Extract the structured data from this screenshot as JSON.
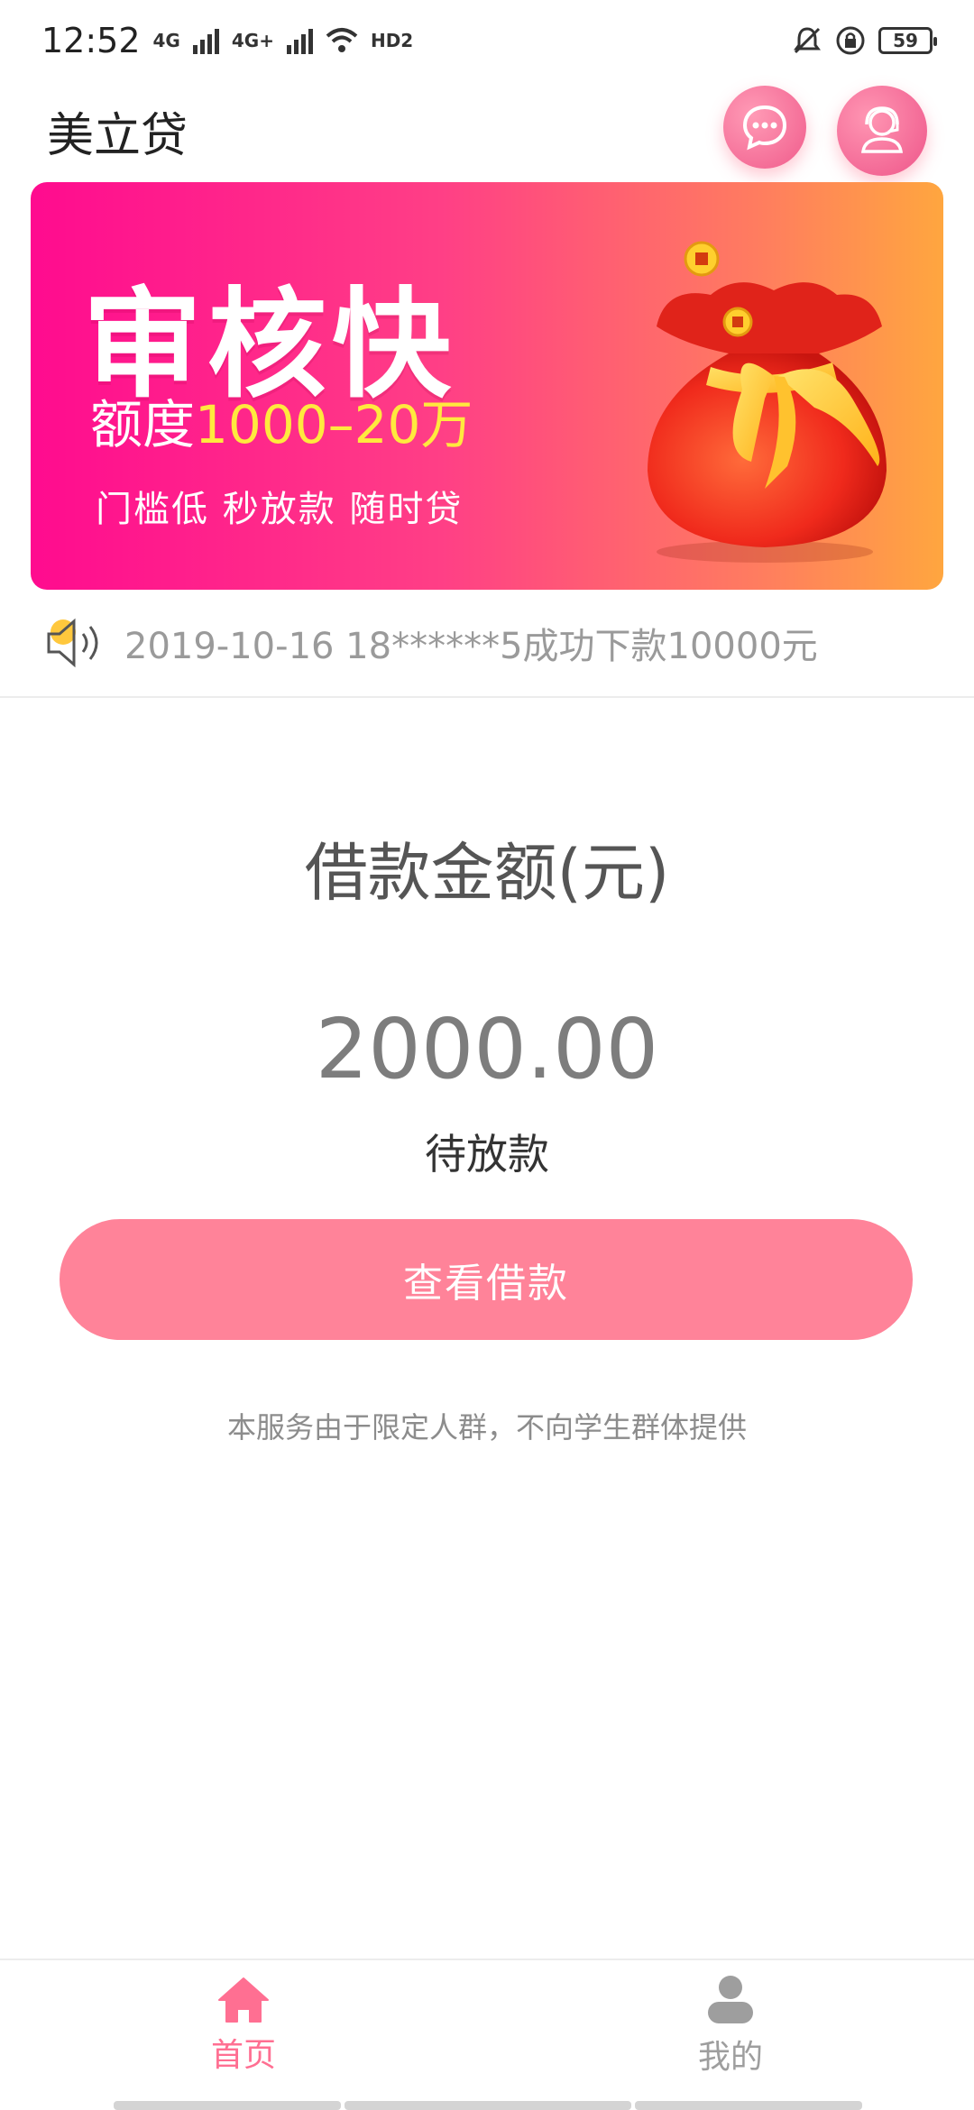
{
  "status_bar": {
    "time": "12:52",
    "network_1": "4G",
    "network_2": "4G+",
    "hd": "HD",
    "hd_sub": "2",
    "battery": "59",
    "icons": [
      "signal-icon",
      "signal-icon",
      "wifi-icon",
      "hd-icon",
      "mute-icon",
      "rotation-lock-icon",
      "battery-icon"
    ]
  },
  "header": {
    "title": "美立贷",
    "actions": [
      "chat-icon",
      "customer-service-icon"
    ]
  },
  "banner": {
    "headline": "审核快",
    "quota_prefix": "额度",
    "quota_amount": "1000–20万",
    "slogan": "门槛低 秒放款  随时贷"
  },
  "notice": {
    "icon": "speaker-icon",
    "text": "2019-10-16 18******5成功下款10000元"
  },
  "loan": {
    "label": "借款金额(元)",
    "amount": "2000.00",
    "status": "待放款",
    "button": "查看借款"
  },
  "disclaimer": "本服务由于限定人群，不向学生群体提供",
  "bottom_nav": {
    "items": [
      {
        "label": "首页",
        "icon": "home-icon",
        "active": true
      },
      {
        "label": "我的",
        "icon": "person-icon",
        "active": false
      }
    ]
  },
  "colors": {
    "accent": "#ff8399",
    "nav_active": "#ff6f92",
    "banner_start": "#ff0b8f",
    "banner_end": "#ffa63f",
    "quota_highlight": "#ffe93e"
  }
}
